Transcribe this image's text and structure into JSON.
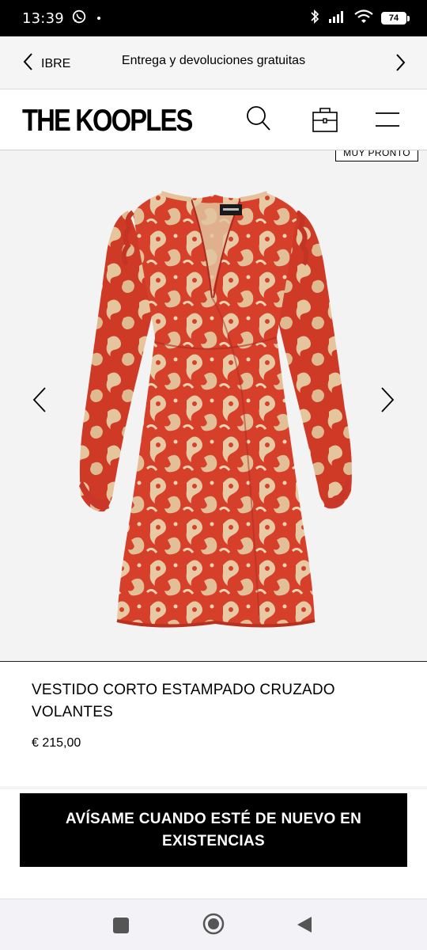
{
  "status_bar": {
    "time": "13:39",
    "notification_icon": "whatsapp-icon",
    "battery_level": "74",
    "icons": [
      "bluetooth-icon",
      "signal-icon",
      "wifi-icon",
      "battery-icon"
    ]
  },
  "promo": {
    "prev_label": "IBRE",
    "text": "Entrega y devoluciones gratuitas"
  },
  "header": {
    "logo": "THE KOOPLES",
    "icons": [
      "search-icon",
      "bag-icon",
      "menu-icon"
    ]
  },
  "gallery": {
    "badge": "MUY PRONTO",
    "colors": {
      "dress_red": "#d6402b",
      "dress_pattern": "#e7c9a3",
      "background": "#f3f3f3"
    }
  },
  "product": {
    "name": "VESTIDO CORTO ESTAMPADO CRUZADO VOLANTES",
    "price": "€ 215,00"
  },
  "cta": {
    "label": "AVÍSAME CUANDO ESTÉ DE NUEVO EN EXISTENCIAS"
  },
  "nav_bar": {
    "buttons": [
      "recent-apps-icon",
      "home-icon",
      "back-icon"
    ]
  }
}
